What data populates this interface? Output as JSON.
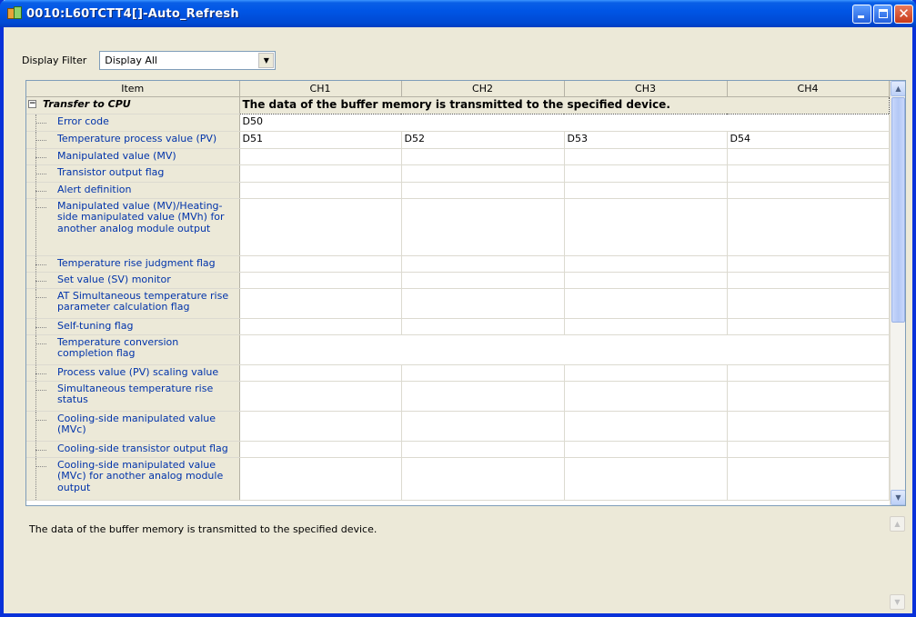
{
  "window": {
    "title": "0010:L60TCTT4[]-Auto_Refresh"
  },
  "filter": {
    "label": "Display Filter",
    "value": "Display All"
  },
  "grid": {
    "headers": [
      "Item",
      "CH1",
      "CH2",
      "CH3",
      "CH4"
    ],
    "group": {
      "label": "Transfer to CPU",
      "expander": "−",
      "description": "The data of the buffer memory is transmitted to the specified device."
    },
    "rows": [
      {
        "label": "Error code",
        "cells": [
          "D50"
        ],
        "span": true
      },
      {
        "label": "Temperature process value (PV)",
        "cells": [
          "D51",
          "D52",
          "D53",
          "D54"
        ]
      },
      {
        "label": "Manipulated value (MV)",
        "cells": [
          "",
          "",
          "",
          ""
        ]
      },
      {
        "label": "Transistor output flag",
        "cells": [
          "",
          "",
          "",
          ""
        ]
      },
      {
        "label": "Alert definition",
        "cells": [
          "",
          "",
          "",
          ""
        ]
      },
      {
        "label": "Manipulated value (MV)/Heating-side manipulated value (MVh) for another analog module output",
        "cells": [
          "",
          "",
          "",
          ""
        ]
      },
      {
        "label": "Temperature rise judgment flag",
        "cells": [
          "",
          "",
          "",
          ""
        ]
      },
      {
        "label": "Set value (SV) monitor",
        "cells": [
          "",
          "",
          "",
          ""
        ]
      },
      {
        "label": "AT Simultaneous temperature rise parameter calculation flag",
        "cells": [
          "",
          "",
          "",
          ""
        ]
      },
      {
        "label": "Self-tuning flag",
        "cells": [
          "",
          "",
          "",
          ""
        ]
      },
      {
        "label": "Temperature conversion completion flag",
        "cells": [
          ""
        ],
        "span": true
      },
      {
        "label": "Process value (PV) scaling value",
        "cells": [
          "",
          "",
          "",
          ""
        ]
      },
      {
        "label": "Simultaneous temperature rise status",
        "cells": [
          "",
          "",
          "",
          ""
        ]
      },
      {
        "label": "Cooling-side manipulated value (MVc)",
        "cells": [
          "",
          "",
          "",
          ""
        ]
      },
      {
        "label": "Cooling-side transistor output flag",
        "cells": [
          "",
          "",
          "",
          ""
        ]
      },
      {
        "label": "Cooling-side manipulated value (MVc) for another analog module output",
        "cells": [
          "",
          "",
          "",
          ""
        ]
      }
    ]
  },
  "description_pane": {
    "text": "The data of the buffer memory is transmitted to the specified device."
  },
  "icons": {
    "app": "app-icon",
    "minimize": "minimize-icon",
    "maximize": "maximize-icon",
    "close": "close-icon",
    "dropdown": "chevron-down-icon"
  }
}
